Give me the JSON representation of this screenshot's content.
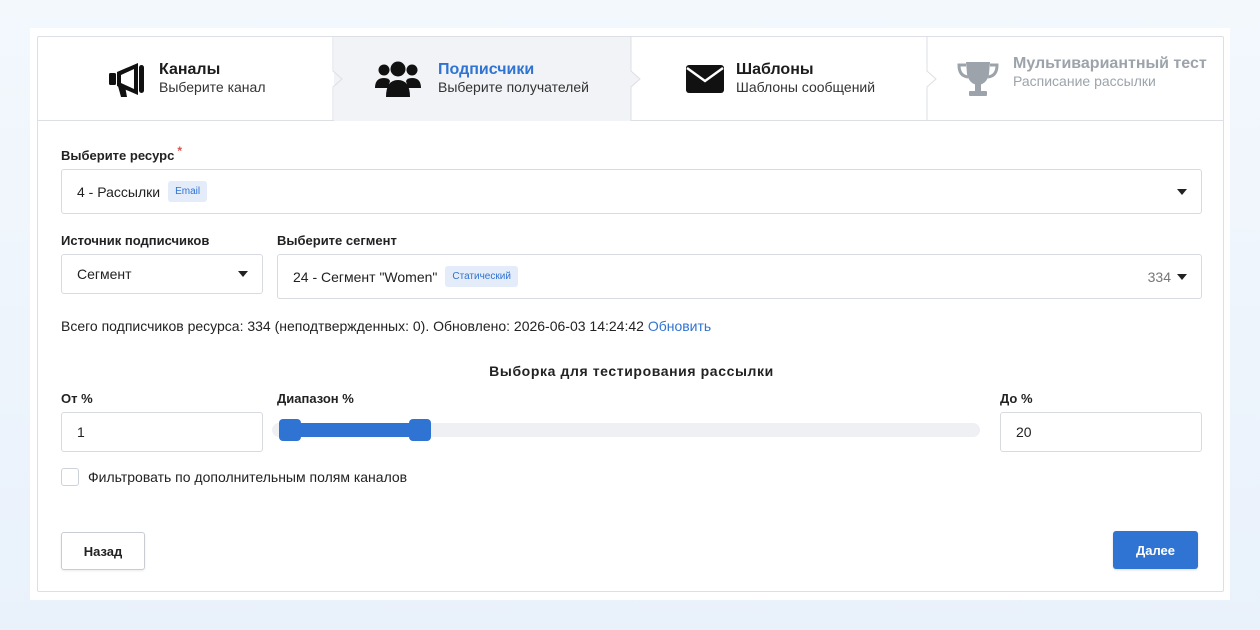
{
  "steps": [
    {
      "title": "Каналы",
      "subtitle": "Выберите канал",
      "icon": "megaphone-icon"
    },
    {
      "title": "Подписчики",
      "subtitle": "Выберите получателей",
      "icon": "users-icon"
    },
    {
      "title": "Шаблоны",
      "subtitle": "Шаблоны сообщений",
      "icon": "envelope-icon"
    },
    {
      "title": "Мультивариантный тест",
      "subtitle": "Расписание рассылки",
      "icon": "trophy-icon"
    }
  ],
  "resource": {
    "label": "Выберите ресурс",
    "required_mark": "*",
    "value": "4 - Рассылки",
    "tag": "Email"
  },
  "source": {
    "label": "Источник подписчиков",
    "value": "Сегмент"
  },
  "segment": {
    "label": "Выберите сегмент",
    "value": "24 - Сегмент \"Women\"",
    "tag": "Статический",
    "count": "334"
  },
  "info": {
    "text": "Всего подписчиков ресурса: 334 (неподтвержденных: 0). Обновлено: 2026-06-03 14:24:42",
    "link": "Обновить"
  },
  "sample": {
    "title": "Выборка для тестирования рассылки",
    "from_label": "От %",
    "range_label": "Диапазон %",
    "to_label": "До %",
    "from_value": "1",
    "to_value": "20",
    "range_from": 1,
    "range_to": 20
  },
  "filter": {
    "label": "Фильтровать по дополнительным полям каналов",
    "checked": false
  },
  "buttons": {
    "back": "Назад",
    "next": "Далее"
  },
  "colors": {
    "accent": "#2f73d3",
    "active_step_bg": "#f1f3f6",
    "disabled_text": "#9ca3ab"
  }
}
